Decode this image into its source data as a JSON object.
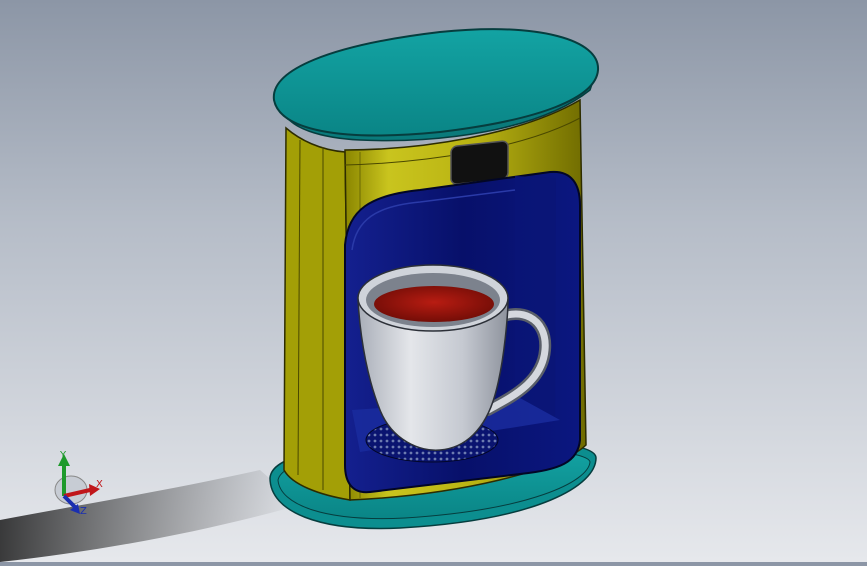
{
  "scene": {
    "subject": "coffee-maker-3d-model",
    "colors": {
      "body": "#c8c21a",
      "body_shade": "#6f6c00",
      "cap": "#0f9a9a",
      "cap_dark": "#0a6e70",
      "recess": "#0b1780",
      "cup": "#cfd3da",
      "liquid": "#a3150d"
    }
  },
  "triad": {
    "x_label": "X",
    "y_label": "Y",
    "z_label": "Z",
    "x_color": "#c0161a",
    "y_color": "#1d9a2b",
    "z_color": "#1a2fb0"
  }
}
